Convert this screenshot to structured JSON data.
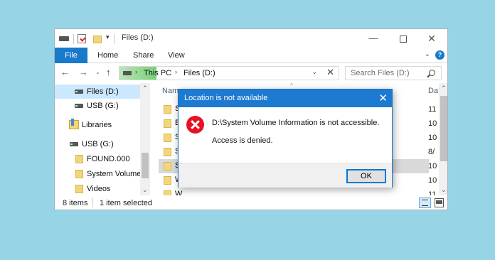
{
  "window": {
    "title": "Files (D:)",
    "controls": {
      "minimize": "—",
      "maximize": "",
      "close": "✕"
    }
  },
  "ribbon": {
    "tabs": [
      "File",
      "Home",
      "Share",
      "View"
    ],
    "chevron": "⌄",
    "help": "?"
  },
  "nav": {
    "back": "←",
    "forward": "→",
    "recent": "⌄",
    "up": "↑",
    "address": {
      "sep": "›",
      "crumbs": [
        "This PC",
        "Files (D:)"
      ],
      "dropdown": "⌄",
      "clear": "✕"
    },
    "search_placeholder": "Search Files (D:)"
  },
  "nav_pane": {
    "items": [
      {
        "label": "Files (D:)",
        "icon": "drive-icon",
        "selected": true
      },
      {
        "label": "USB (G:)",
        "icon": "drive-icon",
        "selected": false
      },
      {
        "label": "Libraries",
        "icon": "libraries-icon",
        "selected": false
      },
      {
        "label": "USB (G:)",
        "icon": "drive-icon",
        "selected": false
      },
      {
        "label": "FOUND.000",
        "icon": "folder-icon",
        "selected": false
      },
      {
        "label": "System Volume I",
        "icon": "folder-icon",
        "selected": false
      },
      {
        "label": "Videos",
        "icon": "folder-icon",
        "selected": false
      }
    ],
    "scroll_up": "⌃",
    "scroll_down": "⌄"
  },
  "file_list": {
    "col_name": "Nam",
    "col_date": "Da",
    "sort_indicator": "^",
    "rows": [
      {
        "name": "S",
        "date": "11",
        "selected": false
      },
      {
        "name": "B",
        "date": "10",
        "selected": false
      },
      {
        "name": "S",
        "date": "10",
        "selected": false
      },
      {
        "name": "S",
        "date": "8/",
        "selected": false
      },
      {
        "name": "S",
        "date": "10",
        "selected": true
      },
      {
        "name": "W",
        "date": "10",
        "selected": false
      },
      {
        "name": "W",
        "date": "11",
        "selected": false
      }
    ],
    "scroll_up": "⌃",
    "scroll_down": "⌄"
  },
  "status": {
    "count": "8 items",
    "selection": "1 item selected"
  },
  "dialog": {
    "title": "Location is not available",
    "close": "✕",
    "message": "D:\\System Volume Information is not accessible.",
    "detail": "Access is denied.",
    "ok_label": "OK"
  },
  "colors": {
    "background": "#96d4e6",
    "accent": "#1979ca",
    "dialog_title": "#1d7ad0",
    "error_red": "#e81123",
    "selection": "#cce8ff"
  }
}
